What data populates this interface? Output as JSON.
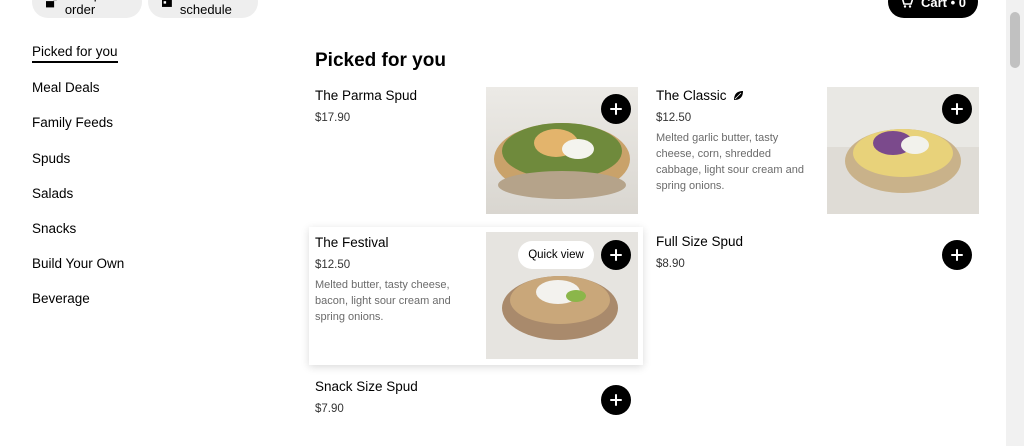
{
  "top": {
    "group_order_label": "Group order",
    "schedule_label": "Edit schedule",
    "cart_label": "Cart • 0"
  },
  "sidebar": {
    "items": [
      {
        "label": "Picked for you",
        "active": true
      },
      {
        "label": "Meal Deals"
      },
      {
        "label": "Family Feeds"
      },
      {
        "label": "Spuds"
      },
      {
        "label": "Salads"
      },
      {
        "label": "Snacks"
      },
      {
        "label": "Build Your Own"
      },
      {
        "label": "Beverage"
      }
    ]
  },
  "main": {
    "title": "Picked for you",
    "quick_view_label": "Quick view",
    "items": [
      {
        "name": "The Parma Spud",
        "price": "$17.90",
        "desc": ""
      },
      {
        "name": "The Classic",
        "price": "$12.50",
        "desc": "Melted garlic butter, tasty cheese, corn, shredded cabbage, light sour cream and spring onions.",
        "icon": "leaf-icon"
      },
      {
        "name": "The Festival",
        "price": "$12.50",
        "desc": "Melted butter, tasty cheese, bacon, light sour cream and spring onions."
      },
      {
        "name": "Full Size Spud",
        "price": "$8.90",
        "desc": ""
      },
      {
        "name": "Snack Size Spud",
        "price": "$7.90",
        "desc": ""
      }
    ]
  }
}
